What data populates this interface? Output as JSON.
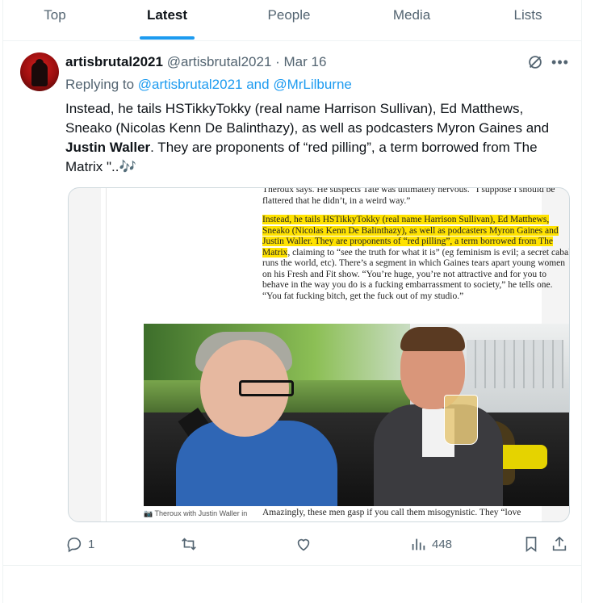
{
  "tabs": [
    {
      "label": "Top"
    },
    {
      "label": "Latest"
    },
    {
      "label": "People"
    },
    {
      "label": "Media"
    },
    {
      "label": "Lists"
    }
  ],
  "tweet": {
    "display_name": "artisbrutal2021",
    "handle": "@artisbrutal2021",
    "separator": " · ",
    "date": "Mar 16",
    "replying_prefix": "Replying to ",
    "replying_to_1": "@artisbrutal2021",
    "replying_and": " and ",
    "replying_to_2": "@MrLilburne",
    "text_part1": "Instead, he tails HSTikkyTokky (real name Harrison Sullivan), Ed  Matthews, Sneako (Nicolas Kenn De Balinthazy), as well as podcasters  Myron Gaines and ",
    "text_bold": "Justin Waller",
    "text_part2": ". They are proponents of “red pilling”, a  term borrowed from The Matrix \"..",
    "text_emoji": "🎶",
    "stats": {
      "replies": "1",
      "retweets": "",
      "likes": "",
      "views": "448"
    }
  },
  "media": {
    "para1": "Theroux says. He suspects Tate was ultimately nervous. “I suppose I should be flattered that he didn’t, in a weird way.”",
    "para2_highlight": "Instead, he tails HSTikkyTokky (real name Harrison Sullivan), Ed Matthews, Sneako (Nicolas Kenn De Balinthazy), as well as podcasters Myron Gaines and Justin Waller. They are proponents of “red pilling”, a term borrowed from The Matrix",
    "para2_rest": ", claiming to “see the truth for what it is” (eg feminism is evil; a secret cabal runs the world, etc). There’s a segment in which Gaines tears apart young women on his Fresh and Fit show. “You’re huge, you’re not attractive and for you to behave in the way you do is a fucking embarrassment to society,” he tells one. “You fat fucking bitch, get the fuck out of my studio.”",
    "para3": "Amazingly, these men gasp if you call them misogynistic. They “love",
    "caption": "Theroux with Justin Waller in"
  },
  "colors": {
    "accent": "#1d9bf0",
    "muted": "#536471",
    "highlight": "#ffe200"
  }
}
